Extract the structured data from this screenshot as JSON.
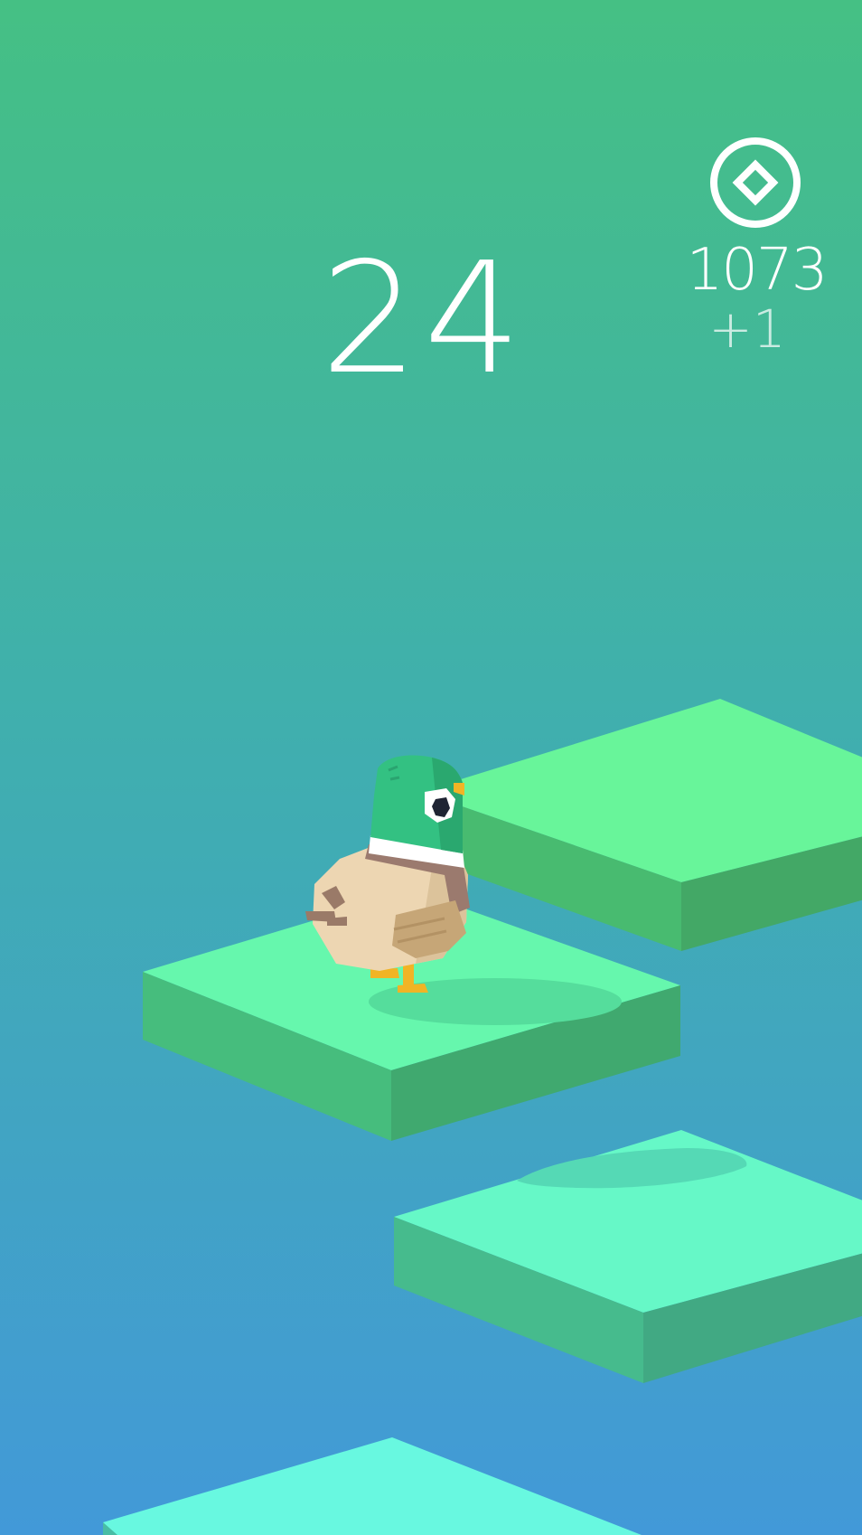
{
  "hud": {
    "score": "24",
    "coins": {
      "icon": "diamond-coin-icon",
      "total": "1073",
      "gain": "+1"
    }
  },
  "player": {
    "character": "mallard-duck"
  },
  "colors": {
    "sky_top": "#45c084",
    "sky_bottom": "#4299d8",
    "tile_front": "#68f59a",
    "tile_back": "#67f7dc"
  }
}
